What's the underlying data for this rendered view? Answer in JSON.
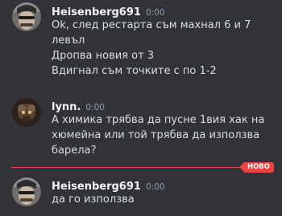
{
  "messages": [
    {
      "author": "Heisenberg691",
      "time": "0:00",
      "lines": [
        "Ok, след рестарта съм махнал 6 и 7",
        "левъл",
        "Дропва новия от 3",
        "Вдигнал съм точките с по 1-2"
      ]
    },
    {
      "author": "lynn.",
      "time": "0:00",
      "lines": [
        "А химика трябва да пусне 1вия хак на",
        "хюмейна или той трябва да използва",
        "барела?"
      ]
    },
    {
      "author": "Heisenberg691",
      "time": "0:00",
      "lines": [
        "да го използва"
      ]
    }
  ],
  "new_divider_label": "НОВО",
  "colors": {
    "background": "#313338",
    "new_divider": "#f23f42",
    "author": "#f2f3f5",
    "timestamp": "#949ba4",
    "text": "#dbdee1"
  }
}
